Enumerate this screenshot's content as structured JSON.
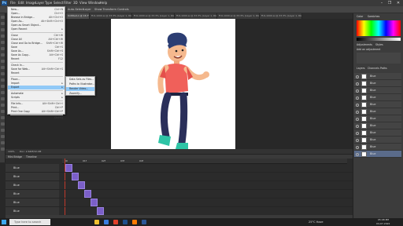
{
  "app": {
    "logo": "Ps"
  },
  "menubar": [
    "File",
    "Edit",
    "Image",
    "Layer",
    "Type",
    "Select",
    "Filter",
    "3D",
    "View",
    "Window",
    "Help"
  ],
  "window_controls": [
    "–",
    "❐",
    "✕"
  ],
  "options_bar": {
    "label": "Auto-Select:",
    "selector": "Layer",
    "transform": "Show Transform Controls"
  },
  "doc_tabs": [
    "Untitled-1 @ 16.7%",
    "ff-6-1000.ai @ 33.3% (Layer 1, RGB/8)",
    "ff-6-1000.ai @ 33.3% (Layer 1, RGB/8)",
    "ff-6-1000.ai @ 33.3% (Layer 1, RGB/8)",
    "ff-6-1000.ai @ 33.3% (Layer 1, RGB/8)",
    "ff-6-1000.ai @ 33.3% (Layer 1, RGB/8)"
  ],
  "file_menu": [
    {
      "label": "New...",
      "shortcut": "Ctrl+N"
    },
    {
      "label": "Open...",
      "shortcut": "Ctrl+O"
    },
    {
      "label": "Browse in Bridge...",
      "shortcut": "Alt+Ctrl+O"
    },
    {
      "label": "Open As...",
      "shortcut": "Alt+Shift+Ctrl+O"
    },
    {
      "label": "Open as Smart Object...",
      "shortcut": ""
    },
    {
      "label": "Open Recent",
      "shortcut": "▸"
    },
    {
      "label": "Close",
      "shortcut": "Ctrl+W"
    },
    {
      "label": "Close All",
      "shortcut": "Alt+Ctrl+W"
    },
    {
      "label": "Close and Go to Bridge...",
      "shortcut": "Shift+Ctrl+W"
    },
    {
      "label": "Save",
      "shortcut": "Ctrl+S"
    },
    {
      "label": "Save As...",
      "shortcut": "Shift+Ctrl+S"
    },
    {
      "label": "Save As Copy...",
      "shortcut": "Alt+Ctrl+S"
    },
    {
      "label": "Revert",
      "shortcut": "F12"
    },
    {
      "label": "Check In...",
      "shortcut": ""
    },
    {
      "label": "Save for Web...",
      "shortcut": "Alt+Shift+Ctrl+S"
    },
    {
      "label": "Revert",
      "shortcut": ""
    },
    {
      "label": "Place...",
      "shortcut": ""
    },
    {
      "label": "Import",
      "shortcut": "▸"
    },
    {
      "label": "Export",
      "shortcut": "▸"
    },
    {
      "label": "Automate",
      "shortcut": "▸"
    },
    {
      "label": "Scripts",
      "shortcut": "▸"
    },
    {
      "label": "File Info...",
      "shortcut": "Alt+Shift+Ctrl+I"
    },
    {
      "label": "Print...",
      "shortcut": "Ctrl+P"
    },
    {
      "label": "Print One Copy",
      "shortcut": "Alt+Shift+Ctrl+P"
    },
    {
      "label": "Exit",
      "shortcut": "Ctrl+Q"
    }
  ],
  "export_submenu": [
    "Data Sets as Files...",
    "Paths to Illustrator...",
    "Render Video...",
    "Zoomify..."
  ],
  "status_bar": {
    "zoom": "100%",
    "doc": "Doc: 2.64M/32.4M"
  },
  "timeline": {
    "title": "Timeline",
    "tab": "Mini Bridge",
    "tracks": [
      "Blue",
      "Blue",
      "Blue",
      "Blue",
      "Blue",
      "Blue"
    ],
    "ruler": [
      "00",
      "01f",
      "02f",
      "03f",
      "04f"
    ]
  },
  "panels": {
    "color_tab": "Color",
    "swatches_tab": "Swatches",
    "adjustments_tab": "Adjustments",
    "styles_tab": "Styles",
    "add_adjustment": "Add an adjustment",
    "layers_tab": "Layers",
    "channels_tab": "Channels",
    "paths_tab": "Paths"
  },
  "layers": [
    "Blue",
    "Blue",
    "Blue",
    "Blue",
    "Blue",
    "Blue",
    "Blue",
    "Blue",
    "Blue",
    "Blue",
    "Blue",
    "Blue"
  ],
  "taskbar": {
    "search": "Type here to search",
    "weather": "25°C Haze",
    "time": "05:08 PM",
    "date": "04-07-2022"
  },
  "colors": {
    "accent": "#7b5fc8",
    "highlight": "#91c9f7"
  }
}
